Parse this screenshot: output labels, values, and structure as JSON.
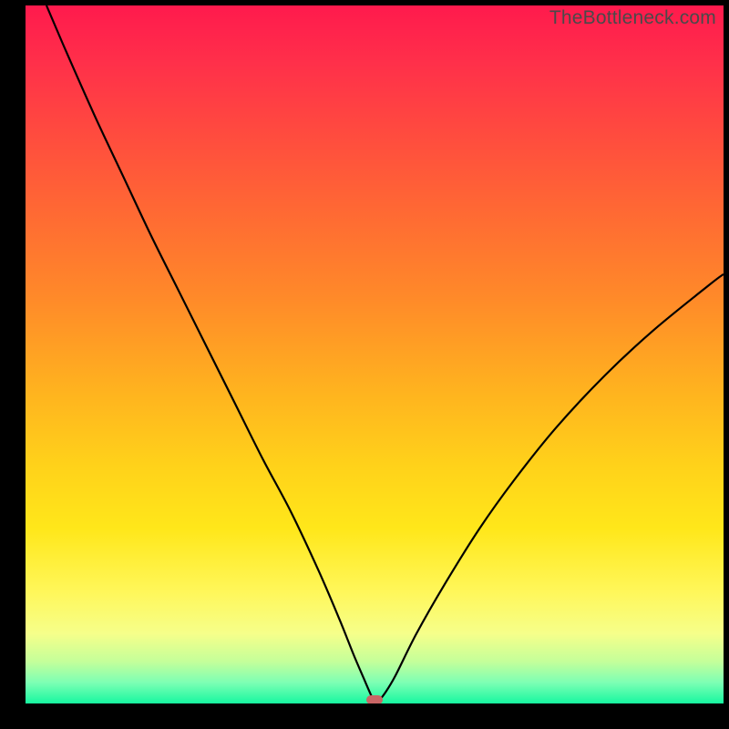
{
  "watermark": "TheBottleneck.com",
  "colors": {
    "curve": "#000000",
    "marker": "#c96565",
    "axis_bg": "#000000"
  },
  "chart_data": {
    "type": "line",
    "title": "",
    "xlabel": "",
    "ylabel": "",
    "xlim": [
      0,
      100
    ],
    "ylim": [
      0,
      100
    ],
    "series": [
      {
        "name": "bottleneck-curve",
        "x": [
          3,
          6,
          10,
          14,
          18,
          22,
          26,
          30,
          34,
          38,
          42,
          45,
          47,
          48.5,
          49.5,
          50,
          50.5,
          51.5,
          53,
          56,
          60,
          65,
          70,
          76,
          83,
          90,
          98,
          100
        ],
        "y": [
          100,
          93,
          84,
          75.5,
          67,
          59,
          51,
          43,
          35,
          27.5,
          19,
          12,
          7,
          3.5,
          1.2,
          0.2,
          0.3,
          1.5,
          4,
          10,
          17,
          25,
          32,
          39.5,
          47,
          53.5,
          60,
          61.5
        ]
      }
    ],
    "marker": {
      "x": 50,
      "y": 0.5
    },
    "note": "V-shaped bottleneck curve. Left branch descends steeply from top-left to minimum near x≈50; right branch rises with decreasing slope toward the right edge, ending around 60% height."
  }
}
